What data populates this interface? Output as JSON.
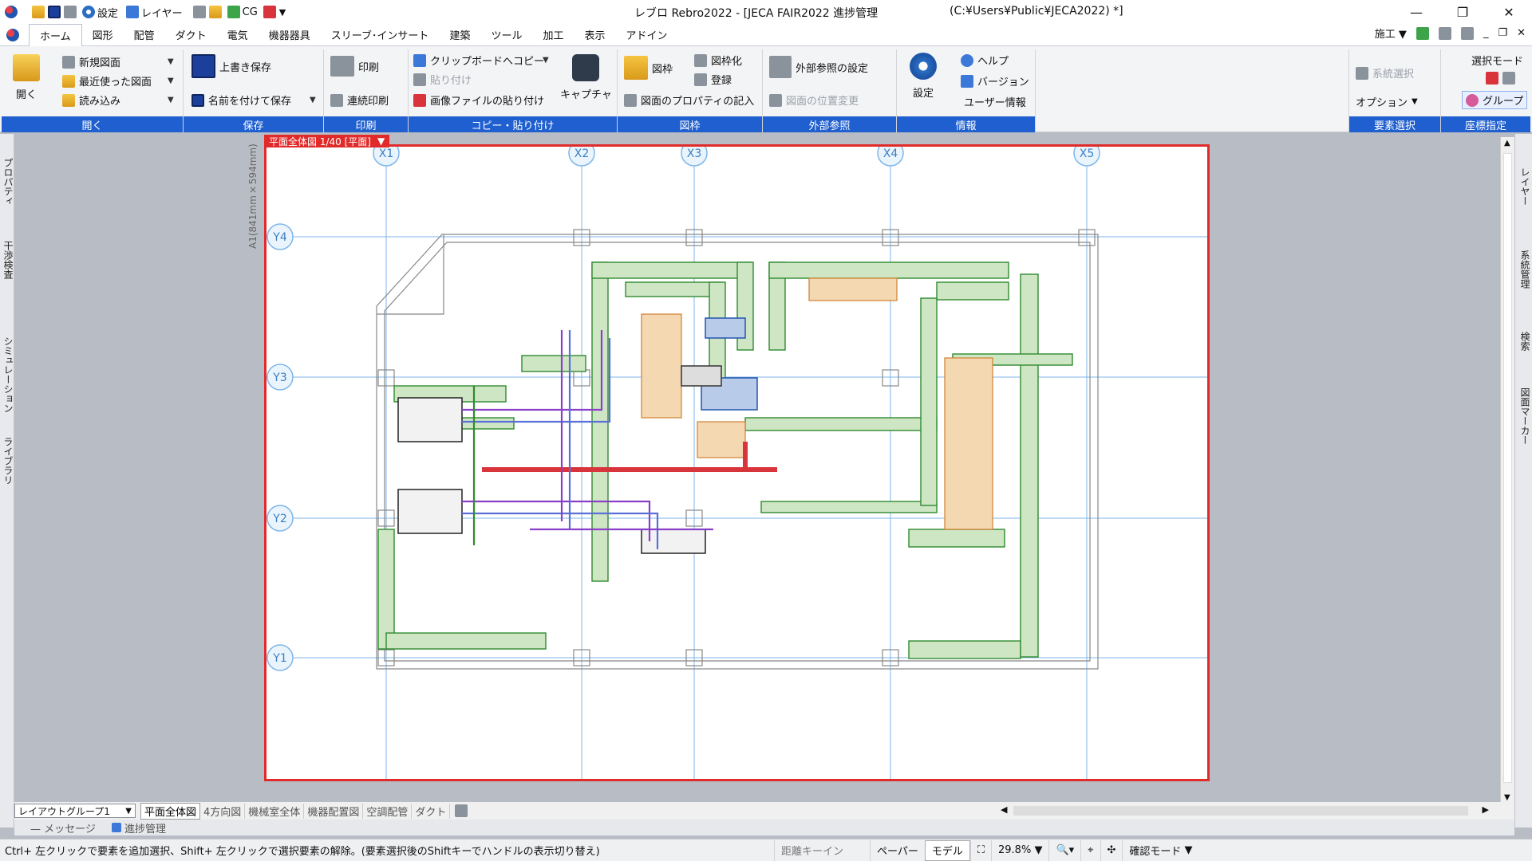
{
  "window": {
    "title": "レブロ Rebro2022 - [JECA FAIR2022 進捗管理",
    "path": "(C:¥Users¥Public¥JECA2022)  *]",
    "qat_settings": "設定",
    "qat_layer": "レイヤー",
    "qat_cg": "CG"
  },
  "tabs": [
    "ホーム",
    "図形",
    "配管",
    "ダクト",
    "電気",
    "機器器具",
    "スリーブ･インサート",
    "建築",
    "ツール",
    "加工",
    "表示",
    "アドイン"
  ],
  "tabbar_right": {
    "mode": "施工"
  },
  "ribbon": {
    "open": {
      "big": "開く",
      "new": "新規図面",
      "recent": "最近使った図面",
      "load": "読み込み",
      "label": "開く"
    },
    "save": {
      "overwrite": "上書き保存",
      "saveas": "名前を付けて保存",
      "label": "保存"
    },
    "print": {
      "print": "印刷",
      "continuous": "連続印刷",
      "label": "印刷"
    },
    "copy": {
      "clip": "クリップボードへコピー",
      "paste": "貼り付け",
      "paste_img": "画像ファイルの貼り付け",
      "capture": "キャプチャ",
      "label": "コピー・貼り付け"
    },
    "frame": {
      "frame": "図枠",
      "frameize": "図枠化",
      "register": "登録",
      "props": "図面のプロパティの記入",
      "label": "図枠"
    },
    "xref": {
      "setting": "外部参照の設定",
      "move": "図面の位置変更",
      "label": "外部参照"
    },
    "info": {
      "settings": "設定",
      "help": "ヘルプ",
      "version": "バージョン",
      "user": "ユーザー情報",
      "label": "情報"
    },
    "elemsel": {
      "system": "系統選択",
      "option": "オプション",
      "label": "要素選択"
    },
    "coord": {
      "selmode": "選択モード",
      "group": "グループ",
      "label": "座標指定"
    }
  },
  "left_panel": [
    "プロパティ",
    "干渉検査",
    "シミュレーション",
    "ライブラリ"
  ],
  "right_panel": [
    "レイヤー",
    "系統管理",
    "検索",
    "図面マーカー"
  ],
  "sheet": {
    "tag": "平面全体図 1/40 [平面]",
    "size_label": "A1(841mm×594mm)"
  },
  "grid": {
    "x": [
      "X1",
      "X2",
      "X3",
      "X4",
      "X5"
    ],
    "y": [
      "Y4",
      "Y3",
      "Y2",
      "Y1"
    ]
  },
  "layout": {
    "group": "レイアウトグループ1",
    "tabs": [
      "平面全体図",
      "4方向図",
      "機械室全体",
      "機器配置図",
      "空調配管",
      "ダクト"
    ]
  },
  "messages": {
    "msg": "メッセージ",
    "progress": "進捗管理"
  },
  "status": {
    "hint": "Ctrl+ 左クリックで要素を追加選択、Shift+ 左クリックで選択要素の解除。(要素選択後のShiftキーでハンドルの表示切り替え)",
    "distance": "距離キーイン",
    "paper": "ペーパー",
    "model": "モデル",
    "zoom": "29.8%",
    "confirm": "確認モード"
  },
  "colors": {
    "accent": "#1f5fcf",
    "sheet_border": "#e12b2b",
    "duct": "#2f8a2f",
    "pipe_purple": "#8a3fc8",
    "pipe_red": "#d8343c"
  }
}
